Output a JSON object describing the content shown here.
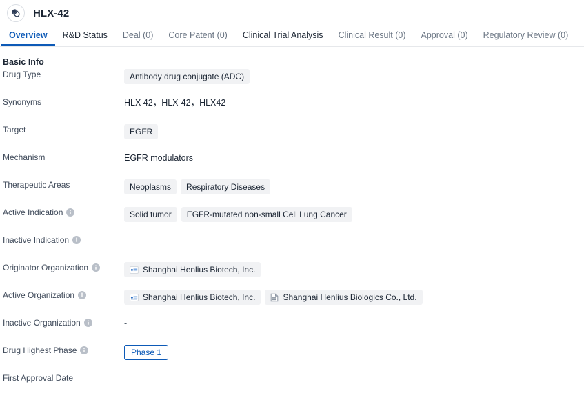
{
  "header": {
    "drug_icon": "capsule-pill-icon",
    "title": "HLX-42"
  },
  "tabs": [
    {
      "label": "Overview",
      "state": "active"
    },
    {
      "label": "R&D Status",
      "state": "enabled"
    },
    {
      "label": "Deal (0)",
      "state": "disabled"
    },
    {
      "label": "Core Patent (0)",
      "state": "disabled"
    },
    {
      "label": "Clinical Trial Analysis",
      "state": "enabled"
    },
    {
      "label": "Clinical Result (0)",
      "state": "disabled"
    },
    {
      "label": "Approval (0)",
      "state": "disabled"
    },
    {
      "label": "Regulatory Review (0)",
      "state": "disabled"
    }
  ],
  "section": {
    "title": "Basic Info"
  },
  "rows": [
    {
      "label": "Drug Type",
      "has_info": false,
      "type": "chips",
      "chips": [
        {
          "text": "Antibody drug conjugate (ADC)",
          "icon": null
        }
      ]
    },
    {
      "label": "Synonyms",
      "has_info": false,
      "type": "text",
      "text": "HLX 42，HLX-42，HLX42"
    },
    {
      "label": "Target",
      "has_info": false,
      "type": "chips",
      "chips": [
        {
          "text": "EGFR",
          "icon": null
        }
      ]
    },
    {
      "label": "Mechanism",
      "has_info": false,
      "type": "text",
      "text": "EGFR modulators"
    },
    {
      "label": "Therapeutic Areas",
      "has_info": false,
      "type": "chips",
      "chips": [
        {
          "text": "Neoplasms",
          "icon": null
        },
        {
          "text": "Respiratory Diseases",
          "icon": null
        }
      ]
    },
    {
      "label": "Active Indication",
      "has_info": true,
      "type": "chips",
      "chips": [
        {
          "text": "Solid tumor",
          "icon": null
        },
        {
          "text": "EGFR-mutated non-small Cell Lung Cancer",
          "icon": null
        }
      ]
    },
    {
      "label": "Inactive Indication",
      "has_info": true,
      "type": "dash",
      "text": "-"
    },
    {
      "label": "Originator Organization",
      "has_info": true,
      "type": "chips",
      "chips": [
        {
          "text": "Shanghai Henlius Biotech, Inc.",
          "icon": "company-logo-icon"
        }
      ]
    },
    {
      "label": "Active Organization",
      "has_info": true,
      "type": "chips",
      "chips": [
        {
          "text": "Shanghai Henlius Biotech, Inc.",
          "icon": "company-logo-icon"
        },
        {
          "text": "Shanghai Henlius Biologics Co., Ltd.",
          "icon": "building-icon"
        }
      ]
    },
    {
      "label": "Inactive Organization",
      "has_info": true,
      "type": "dash",
      "text": "-"
    },
    {
      "label": "Drug Highest Phase",
      "has_info": true,
      "type": "phase",
      "text": "Phase 1"
    },
    {
      "label": "First Approval Date",
      "has_info": false,
      "type": "dash",
      "text": "-"
    }
  ],
  "colors": {
    "accent": "#0d5ab7",
    "text": "#1b2533",
    "label": "#3f4a5a",
    "muted": "#6b7684",
    "chip_bg": "#f1f2f4",
    "divider": "#e6e8eb"
  }
}
